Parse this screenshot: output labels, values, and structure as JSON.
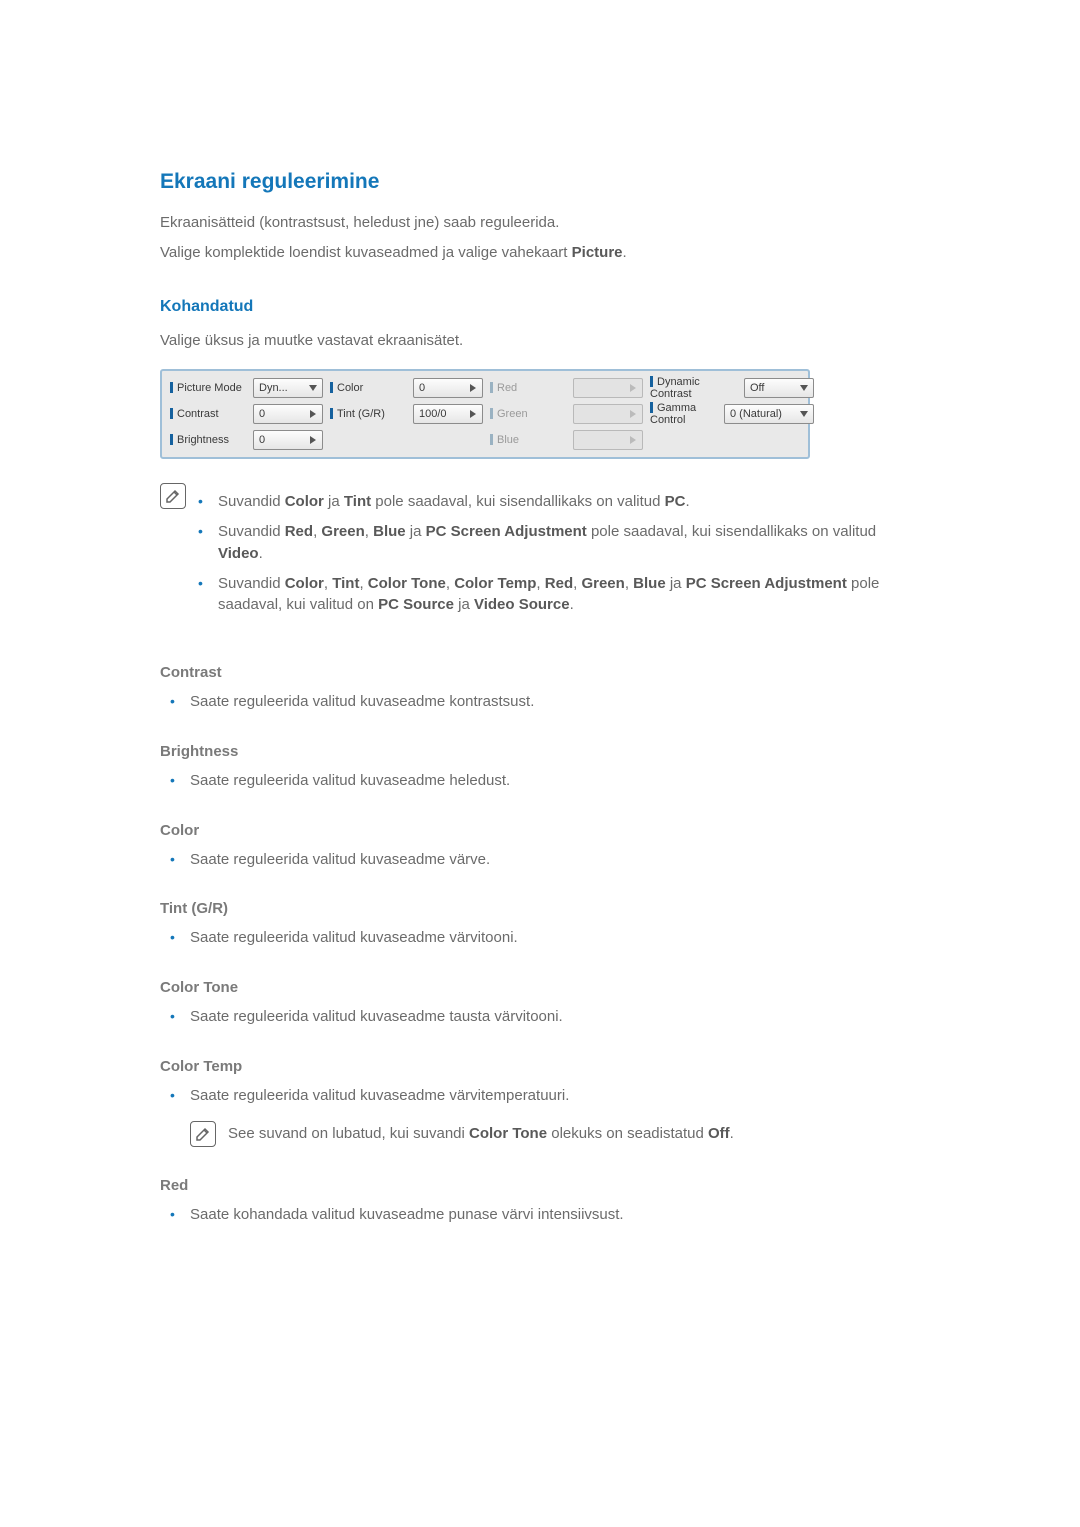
{
  "headings": {
    "main": "Ekraani reguleerimine",
    "sub1": "Kohandatud"
  },
  "intro": {
    "p1_a": "Ekraanisätteid (kontrastsust, heledust jne) saab reguleerida.",
    "p2_a": "Valige komplektide loendist kuvaseadmed ja valige vahekaart ",
    "p2_b": "Picture",
    "p2_c": "."
  },
  "custom_intro": "Valige üksus ja muutke vastavat ekraanisätet.",
  "panel": {
    "col1": [
      {
        "label": "Picture Mode",
        "value": "Dyn...",
        "type": "dropdown",
        "enabled": true
      },
      {
        "label": "Contrast",
        "value": "0",
        "type": "spinner",
        "enabled": true
      },
      {
        "label": "Brightness",
        "value": "0",
        "type": "spinner",
        "enabled": true
      }
    ],
    "col2": [
      {
        "label": "Color",
        "value": "0",
        "type": "spinner",
        "enabled": true
      },
      {
        "label": "Tint (G/R)",
        "value": "100/0",
        "type": "spinner",
        "enabled": true
      }
    ],
    "col3": [
      {
        "label": "Red",
        "value": "",
        "type": "spinner",
        "enabled": false
      },
      {
        "label": "Green",
        "value": "",
        "type": "spinner",
        "enabled": false
      },
      {
        "label": "Blue",
        "value": "",
        "type": "spinner",
        "enabled": false
      }
    ],
    "col4": [
      {
        "label": "Dynamic Contrast",
        "value": "Off",
        "type": "dropdown",
        "enabled": true
      },
      {
        "label": "Gamma Control",
        "value": "0 (Natural)",
        "type": "dropdown",
        "enabled": true
      }
    ]
  },
  "notes": {
    "n1_a": "Suvandid ",
    "n1_b": "Color",
    "n1_c": " ja ",
    "n1_d": "Tint",
    "n1_e": " pole saadaval, kui sisendallikaks on valitud ",
    "n1_f": "PC",
    "n1_g": ".",
    "n2_a": "Suvandid ",
    "n2_b": "Red",
    "n2_c": ", ",
    "n2_d": "Green",
    "n2_e": ", ",
    "n2_f": "Blue",
    "n2_g": " ja ",
    "n2_h": "PC Screen Adjustment",
    "n2_i": " pole saadaval, kui sisendallikaks on valitud ",
    "n2_j": "Video",
    "n2_k": ".",
    "n3_a": "Suvandid ",
    "n3_b": "Color",
    "n3_c": ", ",
    "n3_d": "Tint",
    "n3_e": ", ",
    "n3_f": "Color Tone",
    "n3_g": ", ",
    "n3_h": "Color Temp",
    "n3_i": ", ",
    "n3_j": "Red",
    "n3_k": ", ",
    "n3_l": "Green",
    "n3_m": ", ",
    "n3_n": "Blue",
    "n3_o": " ja ",
    "n3_p": "PC Screen Adjustment",
    "n3_q": " pole saadaval, kui valitud on ",
    "n3_r": "PC Source",
    "n3_s": " ja ",
    "n3_t": "Video Source",
    "n3_u": "."
  },
  "sections": {
    "contrast": {
      "title": "Contrast",
      "desc": "Saate reguleerida valitud kuvaseadme kontrastsust."
    },
    "brightness": {
      "title": "Brightness",
      "desc": "Saate reguleerida valitud kuvaseadme heledust."
    },
    "color": {
      "title": "Color",
      "desc": "Saate reguleerida valitud kuvaseadme värve."
    },
    "tint": {
      "title": "Tint (G/R)",
      "desc": "Saate reguleerida valitud kuvaseadme värvitooni."
    },
    "colortone": {
      "title": "Color Tone",
      "desc": "Saate reguleerida valitud kuvaseadme tausta värvitooni."
    },
    "colortemp": {
      "title": "Color Temp",
      "desc": "Saate reguleerida valitud kuvaseadme värvitemperatuuri.",
      "note_a": "See suvand on lubatud, kui suvandi ",
      "note_b": "Color Tone",
      "note_c": " olekuks on seadistatud ",
      "note_d": "Off",
      "note_e": "."
    },
    "red": {
      "title": "Red",
      "desc": "Saate kohandada valitud kuvaseadme punase värvi intensiivsust."
    }
  }
}
